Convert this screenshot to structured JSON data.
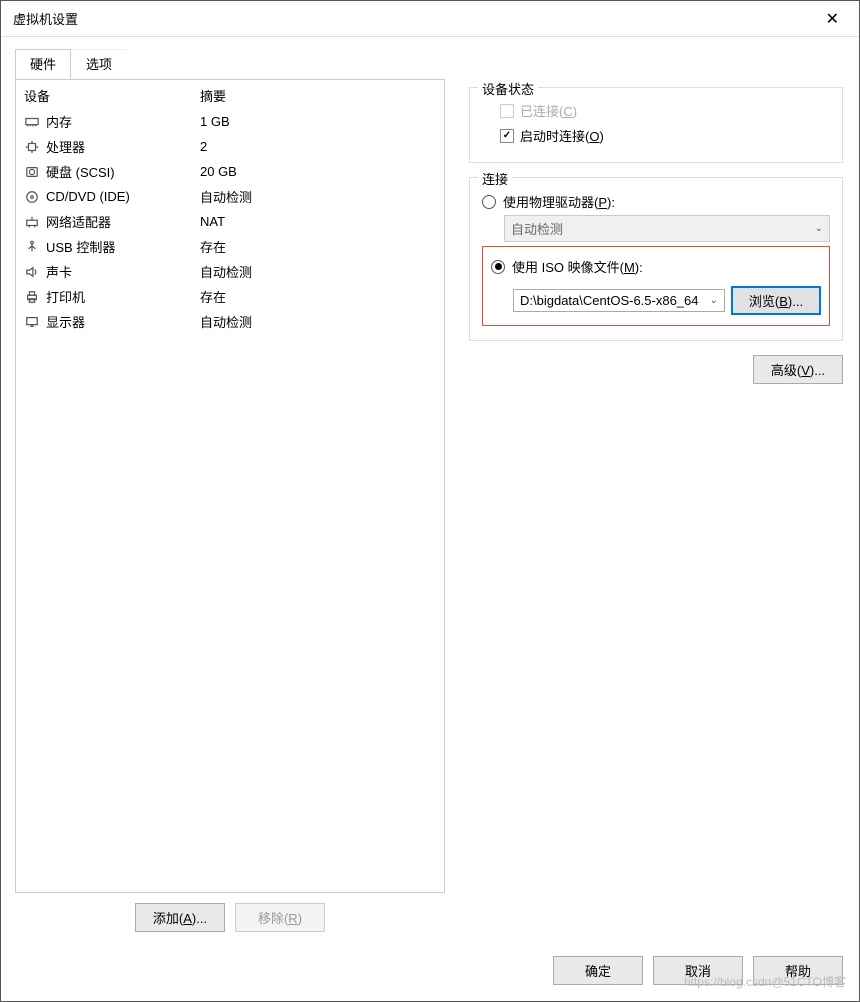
{
  "window": {
    "title": "虚拟机设置"
  },
  "tabs": {
    "hardware": "硬件",
    "options": "选项"
  },
  "list": {
    "col_device": "设备",
    "col_summary": "摘要",
    "items": [
      {
        "icon": "memory",
        "name": "内存",
        "summary": "1 GB"
      },
      {
        "icon": "cpu",
        "name": "处理器",
        "summary": "2"
      },
      {
        "icon": "hdd",
        "name": "硬盘 (SCSI)",
        "summary": "20 GB"
      },
      {
        "icon": "cd",
        "name": "CD/DVD (IDE)",
        "summary": "自动检测"
      },
      {
        "icon": "net",
        "name": "网络适配器",
        "summary": "NAT"
      },
      {
        "icon": "usb",
        "name": "USB 控制器",
        "summary": "存在"
      },
      {
        "icon": "sound",
        "name": "声卡",
        "summary": "自动检测"
      },
      {
        "icon": "printer",
        "name": "打印机",
        "summary": "存在"
      },
      {
        "icon": "display",
        "name": "显示器",
        "summary": "自动检测"
      }
    ]
  },
  "left_buttons": {
    "add_pre": "添加(",
    "add_hot": "A",
    "add_post": ")...",
    "remove_pre": "移除(",
    "remove_hot": "R",
    "remove_post": ")"
  },
  "device_status": {
    "title": "设备状态",
    "connected_pre": "已连接(",
    "connected_hot": "C",
    "connected_post": ")",
    "connect_power_pre": "启动时连接(",
    "connect_power_hot": "O",
    "connect_power_post": ")"
  },
  "connection": {
    "title": "连接",
    "physical_pre": "使用物理驱动器(",
    "physical_hot": "P",
    "physical_post": "):",
    "physical_value": "自动检测",
    "iso_pre": "使用 ISO 映像文件(",
    "iso_hot": "M",
    "iso_post": "):",
    "iso_value": "D:\\bigdata\\CentOS-6.5-x86_64",
    "browse_pre": "浏览(",
    "browse_hot": "B",
    "browse_post": ")..."
  },
  "advanced": {
    "pre": "高级(",
    "hot": "V",
    "post": ")..."
  },
  "footer": {
    "ok": "确定",
    "cancel": "取消",
    "help": "帮助"
  },
  "watermark": "https://blog.csdn@51CTO博客"
}
